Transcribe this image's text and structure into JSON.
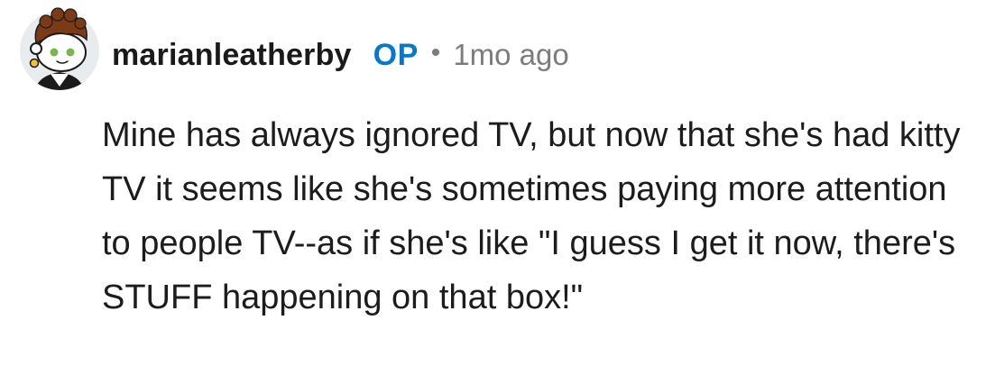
{
  "comment": {
    "author": "marianleatherby",
    "op_label": "OP",
    "separator": "•",
    "age": "1mo ago",
    "text": "Mine has always ignored TV, but now that she's had kitty TV it seems like she's sometimes paying more attention to people TV--as if she's like \"I guess I get it now, there's STUFF happening on that box!\""
  },
  "avatar": {
    "icon": "snoo-avatar-icon",
    "colors": {
      "background": "#e9ecef",
      "skin": "#ffffff",
      "hair": "#7a3b16",
      "earring": "#f2c230",
      "eyes": "#7ab648",
      "shirt": "#1b1b1b"
    }
  },
  "colors": {
    "op_blue": "#0079d3",
    "meta_gray": "#7c7c7c",
    "text": "#1c1c1c"
  }
}
